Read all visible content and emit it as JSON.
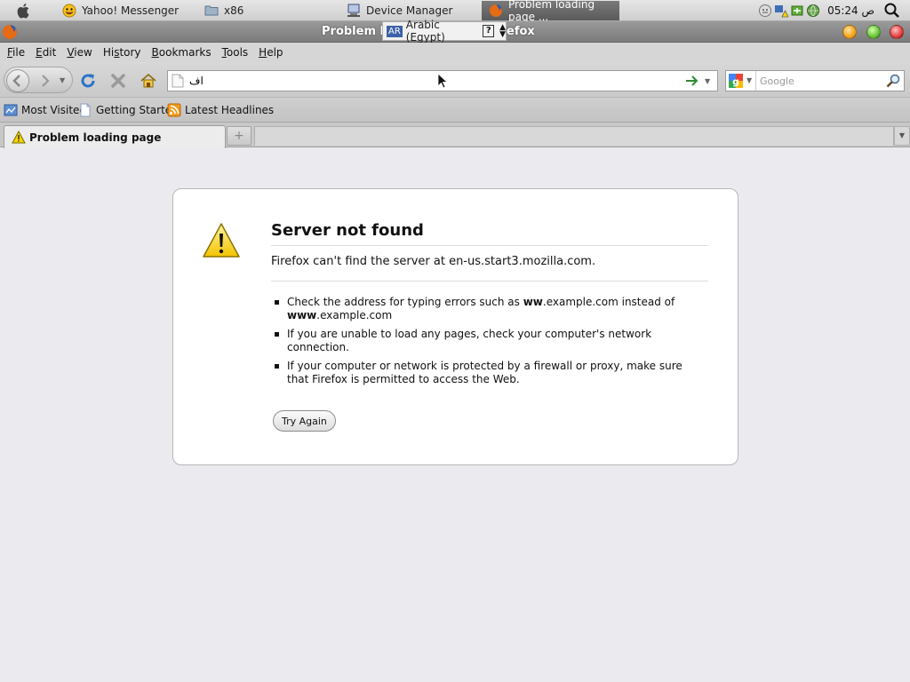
{
  "panel": {
    "tasks": [
      {
        "label": "Yahoo! Messenger",
        "icon": "yahoo-smiley-icon"
      },
      {
        "label": "x86",
        "icon": "folder-icon"
      },
      {
        "label": "Device Manager",
        "icon": "computer-icon"
      },
      {
        "label": "Problem loading page ...",
        "icon": "firefox-icon"
      }
    ],
    "clock": "05:24 ص"
  },
  "window": {
    "title_left": "Problem l",
    "title_right": "efox"
  },
  "ime": {
    "badge": "AR",
    "label": "Arabic (Egypt)",
    "help": "?"
  },
  "menubar": {
    "items": [
      {
        "u": "F",
        "rest": "ile"
      },
      {
        "u": "E",
        "rest": "dit"
      },
      {
        "u": "V",
        "rest": "iew"
      },
      {
        "pre": "Hi",
        "u": "s",
        "rest": "tory"
      },
      {
        "u": "B",
        "rest": "ookmarks"
      },
      {
        "u": "T",
        "rest": "ools"
      },
      {
        "u": "H",
        "rest": "elp"
      }
    ]
  },
  "navbar": {
    "url": "اف",
    "search_placeholder": "Google"
  },
  "bookmarks": [
    {
      "label": "Most Visited",
      "icon": "most-visited-icon"
    },
    {
      "label": "Getting Started",
      "icon": "page-icon"
    },
    {
      "label": "Latest Headlines",
      "icon": "rss-icon"
    }
  ],
  "tab": {
    "label": "Problem loading page",
    "newtab": "+"
  },
  "error": {
    "title": "Server not found",
    "description": "Firefox can't find the server at en-us.start3.mozilla.com.",
    "item1_pre": "Check the address for typing errors such as ",
    "item1_b1": "ww",
    "item1_mid": ".example.com instead of ",
    "item1_b2": "www",
    "item1_post": ".example.com",
    "item2": "If you are unable to load any pages, check your computer's network connection.",
    "item3": "If your computer or network is protected by a firewall or proxy, make sure that Firefox is permitted to access the Web.",
    "button": "Try Again"
  },
  "colors": {
    "warning_yellow": "#f5d400",
    "titlebar_gray": "#8a8a8a",
    "reload_blue": "#2a73c9"
  }
}
